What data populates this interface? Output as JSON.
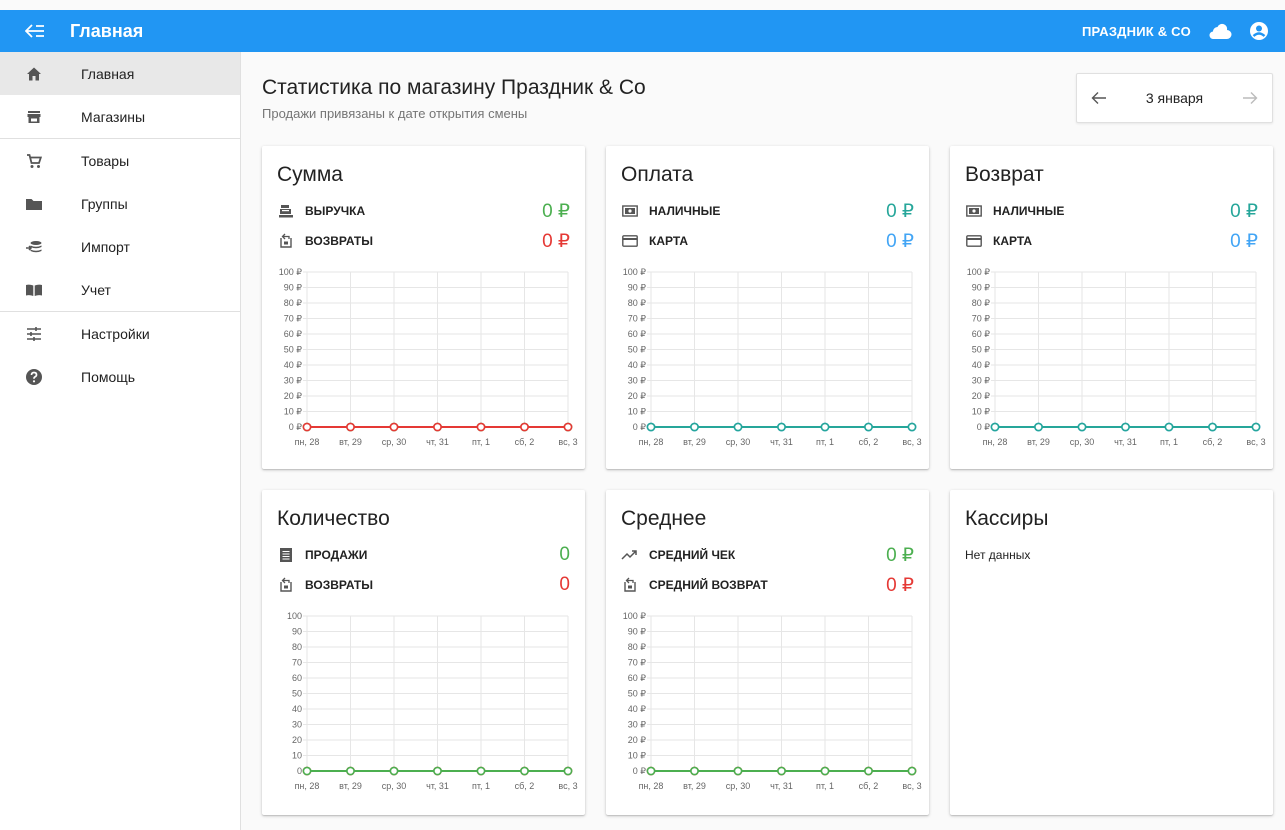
{
  "header": {
    "title": "Главная",
    "company": "ПРАЗДНИК & CO",
    "back_icon": "menu-collapse-icon",
    "cloud_icon": "cloud-icon",
    "account_icon": "account-circle-icon",
    "color": "#2196f3"
  },
  "sidebar": {
    "items": [
      {
        "label": "Главная",
        "icon": "home-icon"
      },
      {
        "label": "Магазины",
        "icon": "store-icon"
      },
      {
        "label": "Товары",
        "icon": "cart-icon"
      },
      {
        "label": "Группы",
        "icon": "folder-icon"
      },
      {
        "label": "Импорт",
        "icon": "import-icon"
      },
      {
        "label": "Учет",
        "icon": "book-icon"
      },
      {
        "label": "Настройки",
        "icon": "tune-icon"
      },
      {
        "label": "Помощь",
        "icon": "help-icon"
      }
    ]
  },
  "page": {
    "title": "Статистика по магазину Праздник & Co",
    "subtitle": "Продажи привязаны к дате открытия смены"
  },
  "datepicker": {
    "date": "3 января",
    "prev_icon": "arrow-left-icon",
    "next_icon": "arrow-right-icon"
  },
  "cards": {
    "sum": {
      "title": "Сумма",
      "metrics": [
        {
          "label": "ВЫРУЧКА",
          "value": "0 ₽",
          "icon": "cash-register-icon",
          "color": "#4caf50"
        },
        {
          "label": "ВОЗВРАТЫ",
          "value": "0 ₽",
          "icon": "refund-icon",
          "color": "#e53935"
        }
      ]
    },
    "payment": {
      "title": "Оплата",
      "metrics": [
        {
          "label": "НАЛИЧНЫЕ",
          "value": "0 ₽",
          "icon": "cash-icon",
          "color": "#26a69a"
        },
        {
          "label": "КАРТА",
          "value": "0 ₽",
          "icon": "credit-card-icon",
          "color": "#42a5f5"
        }
      ]
    },
    "refund": {
      "title": "Возврат",
      "metrics": [
        {
          "label": "НАЛИЧНЫЕ",
          "value": "0 ₽",
          "icon": "cash-icon",
          "color": "#26a69a"
        },
        {
          "label": "КАРТА",
          "value": "0 ₽",
          "icon": "credit-card-icon",
          "color": "#42a5f5"
        }
      ]
    },
    "quantity": {
      "title": "Количество",
      "metrics": [
        {
          "label": "ПРОДАЖИ",
          "value": "0",
          "icon": "receipt-icon",
          "color": "#4caf50"
        },
        {
          "label": "ВОЗВРАТЫ",
          "value": "0",
          "icon": "refund-icon",
          "color": "#e53935"
        }
      ]
    },
    "average": {
      "title": "Среднее",
      "metrics": [
        {
          "label": "СРЕДНИЙ ЧЕК",
          "value": "0 ₽",
          "icon": "trending-up-icon",
          "color": "#4caf50"
        },
        {
          "label": "СРЕДНИЙ ВОЗВРАТ",
          "value": "0 ₽",
          "icon": "refund-icon",
          "color": "#e53935"
        }
      ]
    },
    "cashiers": {
      "title": "Кассиры",
      "empty": "Нет данных"
    }
  },
  "chart_data": [
    {
      "type": "line",
      "categories": [
        "пн, 28",
        "вт, 29",
        "ср, 30",
        "чт, 31",
        "пт, 1",
        "сб, 2",
        "вс, 3"
      ],
      "yticks": [
        "0 ₽",
        "10 ₽",
        "20 ₽",
        "30 ₽",
        "40 ₽",
        "50 ₽",
        "60 ₽",
        "70 ₽",
        "80 ₽",
        "90 ₽",
        "100 ₽"
      ],
      "ylim": [
        0,
        100
      ],
      "grid": true,
      "series": [
        {
          "values": [
            0,
            0,
            0,
            0,
            0,
            0,
            0
          ],
          "color": "#4caf50"
        },
        {
          "values": [
            0,
            0,
            0,
            0,
            0,
            0,
            0
          ],
          "color": "#e53935"
        }
      ]
    },
    {
      "type": "line",
      "categories": [
        "пн, 28",
        "вт, 29",
        "ср, 30",
        "чт, 31",
        "пт, 1",
        "сб, 2",
        "вс, 3"
      ],
      "yticks": [
        "0 ₽",
        "10 ₽",
        "20 ₽",
        "30 ₽",
        "40 ₽",
        "50 ₽",
        "60 ₽",
        "70 ₽",
        "80 ₽",
        "90 ₽",
        "100 ₽"
      ],
      "ylim": [
        0,
        100
      ],
      "grid": true,
      "series": [
        {
          "values": [
            0,
            0,
            0,
            0,
            0,
            0,
            0
          ],
          "color": "#42a5f5"
        },
        {
          "values": [
            0,
            0,
            0,
            0,
            0,
            0,
            0
          ],
          "color": "#26a69a"
        }
      ]
    },
    {
      "type": "line",
      "categories": [
        "пн, 28",
        "вт, 29",
        "ср, 30",
        "чт, 31",
        "пт, 1",
        "сб, 2",
        "вс, 3"
      ],
      "yticks": [
        "0 ₽",
        "10 ₽",
        "20 ₽",
        "30 ₽",
        "40 ₽",
        "50 ₽",
        "60 ₽",
        "70 ₽",
        "80 ₽",
        "90 ₽",
        "100 ₽"
      ],
      "ylim": [
        0,
        100
      ],
      "grid": true,
      "series": [
        {
          "values": [
            0,
            0,
            0,
            0,
            0,
            0,
            0
          ],
          "color": "#42a5f5"
        },
        {
          "values": [
            0,
            0,
            0,
            0,
            0,
            0,
            0
          ],
          "color": "#26a69a"
        }
      ]
    },
    {
      "type": "line",
      "categories": [
        "пн, 28",
        "вт, 29",
        "ср, 30",
        "чт, 31",
        "пт, 1",
        "сб, 2",
        "вс, 3"
      ],
      "yticks": [
        "0",
        "10",
        "20",
        "30",
        "40",
        "50",
        "60",
        "70",
        "80",
        "90",
        "100"
      ],
      "ylim": [
        0,
        100
      ],
      "grid": true,
      "series": [
        {
          "values": [
            0,
            0,
            0,
            0,
            0,
            0,
            0
          ],
          "color": "#e53935"
        },
        {
          "values": [
            0,
            0,
            0,
            0,
            0,
            0,
            0
          ],
          "color": "#4caf50"
        }
      ]
    },
    {
      "type": "line",
      "categories": [
        "пн, 28",
        "вт, 29",
        "ср, 30",
        "чт, 31",
        "пт, 1",
        "сб, 2",
        "вс, 3"
      ],
      "yticks": [
        "0 ₽",
        "10 ₽",
        "20 ₽",
        "30 ₽",
        "40 ₽",
        "50 ₽",
        "60 ₽",
        "70 ₽",
        "80 ₽",
        "90 ₽",
        "100 ₽"
      ],
      "ylim": [
        0,
        100
      ],
      "grid": true,
      "series": [
        {
          "values": [
            0,
            0,
            0,
            0,
            0,
            0,
            0
          ],
          "color": "#e53935"
        },
        {
          "values": [
            0,
            0,
            0,
            0,
            0,
            0,
            0
          ],
          "color": "#4caf50"
        }
      ]
    }
  ]
}
